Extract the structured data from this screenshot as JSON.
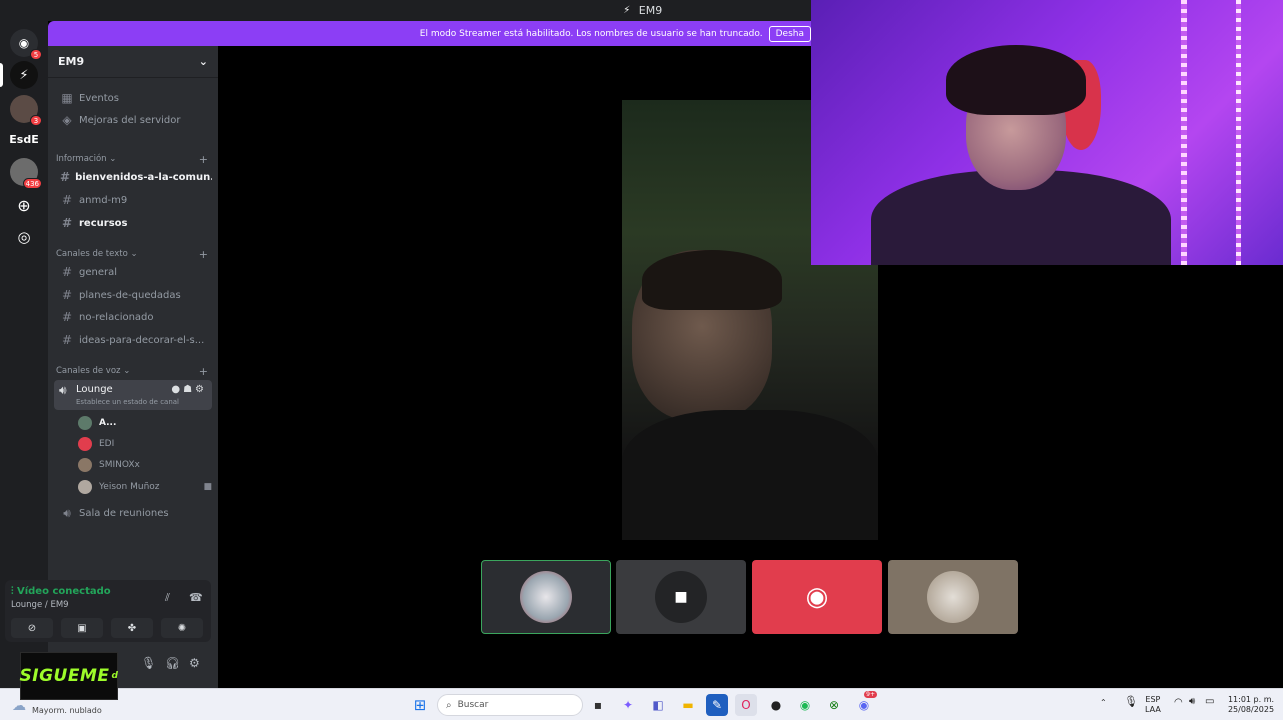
{
  "window": {
    "title": "EM9"
  },
  "rail": {
    "home_badge": "5",
    "server3_badge": "3",
    "server_text": "EsdE",
    "server5_badge": "436"
  },
  "banner": {
    "text": "El modo Streamer está habilitado. Los nombres de usuario se han truncado.",
    "button": "Desha"
  },
  "sidebar": {
    "server_name": "EM9",
    "events": "Eventos",
    "boosts": "Mejoras del servidor",
    "categories": {
      "info": "Información",
      "text": "Canales de texto",
      "voice": "Canales de voz"
    },
    "info_channels": [
      "bienvenidos-a-la-comun...",
      "anmd-m9",
      "recursos"
    ],
    "text_channels": [
      "general",
      "planes-de-quedadas",
      "no-relacionado",
      "ideas-para-decorar-el-s..."
    ],
    "voice_channel": {
      "name": "Lounge",
      "status": "Establece un estado de canal"
    },
    "voice_members": [
      "A...",
      "EDI",
      "SMINOXx",
      "Yeison Muñoz"
    ],
    "meeting_room": "Sala de reuniones"
  },
  "voice_panel": {
    "status": "Vídeo conectado",
    "location": "Lounge / EM9"
  },
  "overlay": {
    "sigueme": "SIGUEME",
    "sigueme_tag": "d"
  },
  "taskbar": {
    "weather": "Mayorm. nublado",
    "search_placeholder": "Buscar",
    "lang_top": "ESP",
    "lang_bottom": "LAA",
    "time": "11:01 p. m.",
    "date": "25/08/2025",
    "discord_badge": "9+"
  },
  "colors": {
    "banner": "#8c3ef5",
    "connected": "#23a55a",
    "discord_red": "#e13d4d",
    "tile_active_border": "#3ba55d"
  }
}
